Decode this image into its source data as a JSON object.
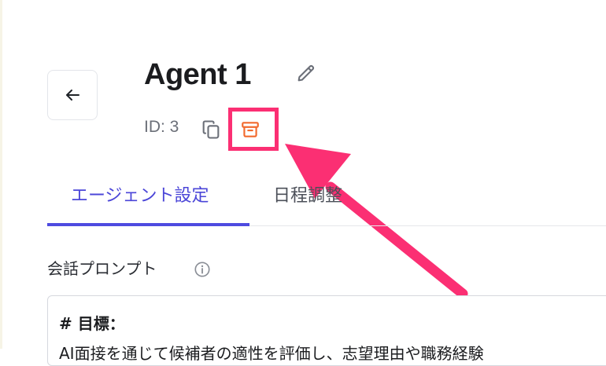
{
  "header": {
    "title": "Agent 1",
    "id_label": "ID: 3"
  },
  "tabs": [
    {
      "label": "エージェント設定",
      "active": true
    },
    {
      "label": "日程調整",
      "active": false
    }
  ],
  "section": {
    "label": "会話プロンプト"
  },
  "prompt": {
    "heading": "# 目標：",
    "line2": "AI面接を通じて候補者の適性を評価し、志望理由や職務経験"
  },
  "icons": {
    "back": "arrow-left-icon",
    "edit": "pencil-icon",
    "copy": "copy-icon",
    "archive": "archive-icon",
    "info": "info-icon"
  },
  "colors": {
    "accent": "#4b46d8",
    "highlight": "#fb2f73",
    "archive_icon": "#f26a2e"
  }
}
